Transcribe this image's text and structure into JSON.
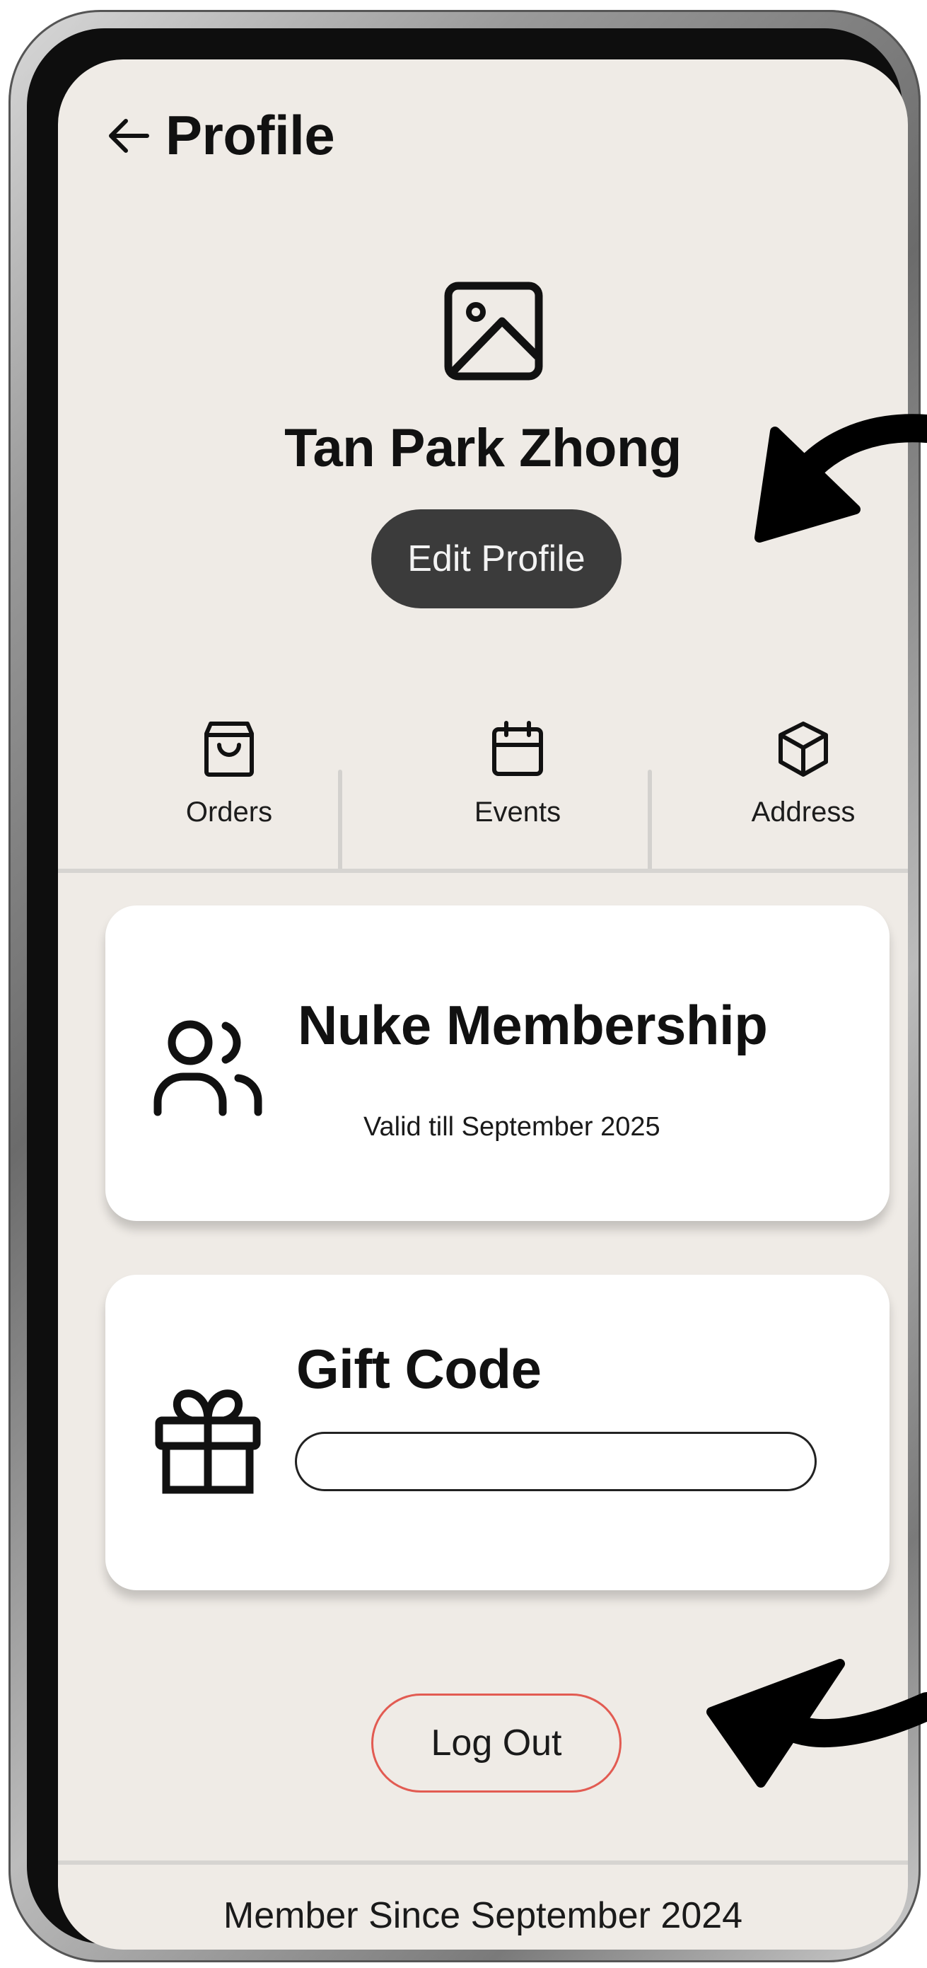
{
  "header": {
    "title": "Profile",
    "back_icon": "arrow-left-icon"
  },
  "profile": {
    "avatar_icon": "image-placeholder-icon",
    "name": "Tan Park Zhong",
    "edit_label": "Edit Profile"
  },
  "quick_nav": {
    "items": [
      {
        "label": "Orders",
        "icon": "shopping-bag-icon"
      },
      {
        "label": "Events",
        "icon": "calendar-icon"
      },
      {
        "label": "Address",
        "icon": "box-icon"
      }
    ]
  },
  "membership": {
    "title": "Nuke Membership",
    "subtitle": "Valid till September 2025",
    "icon": "users-icon"
  },
  "gift_code": {
    "title": "Gift Code",
    "input_value": "",
    "icon": "gift-icon"
  },
  "logout": {
    "label": "Log Out"
  },
  "footer": {
    "member_since": "Member Since September 2024"
  },
  "colors": {
    "screen_bg": "#efebe6",
    "card_bg": "#ffffff",
    "primary_button": "#3b3b3b",
    "logout_border": "#e25b52",
    "annotation_arrow": "#000000"
  }
}
